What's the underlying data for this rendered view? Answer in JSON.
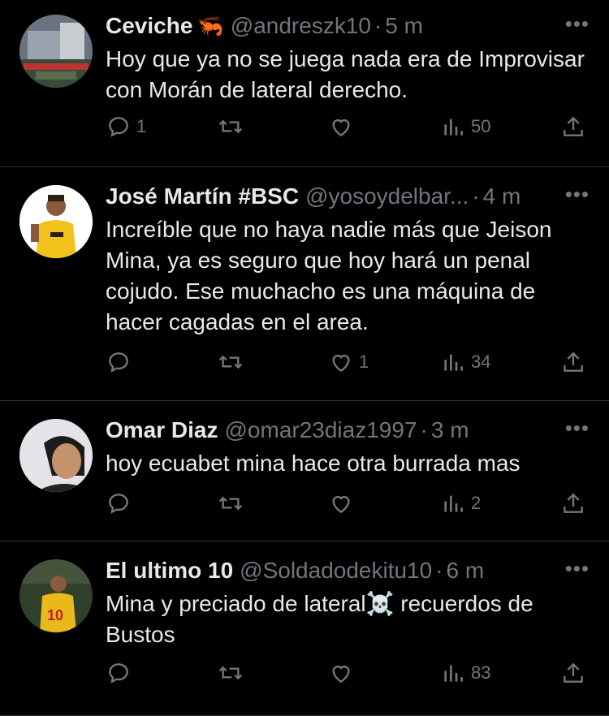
{
  "tweets": [
    {
      "name": "Ceviche",
      "emoji": "🦐",
      "handle": "@andreszk10",
      "time": "5 m",
      "text": "Hoy que ya no se juega nada era de Improvisar con Morán de lateral derecho.",
      "replies": "1",
      "retweets": "",
      "likes": "",
      "views": "50"
    },
    {
      "name": "José Martín #BSC",
      "emoji": "",
      "handle": "@yosoydelbar...",
      "time": "4 m",
      "text": "Increíble que no haya nadie más que Jeison Mina, ya es seguro que hoy hará un penal cojudo. Ese muchacho es una máquina de hacer cagadas en el area.",
      "replies": "",
      "retweets": "",
      "likes": "1",
      "views": "34"
    },
    {
      "name": "Omar Diaz",
      "emoji": "",
      "handle": "@omar23diaz1997",
      "time": "3 m",
      "text": "hoy ecuabet mina hace otra burrada mas",
      "replies": "",
      "retweets": "",
      "likes": "",
      "views": "2"
    },
    {
      "name": "El ultimo 10",
      "emoji": "",
      "handle": "@Soldadodekitu10",
      "time": "6 m",
      "text": "Mina y preciado de lateral☠️ recuerdos de Bustos",
      "replies": "",
      "retweets": "",
      "likes": "",
      "views": "83"
    }
  ],
  "ui": {
    "more": "•••",
    "separator": "·"
  },
  "colors": {
    "background": "#000000",
    "text": "#e7e9ea",
    "muted": "#71767b",
    "divider": "#2f3336"
  }
}
